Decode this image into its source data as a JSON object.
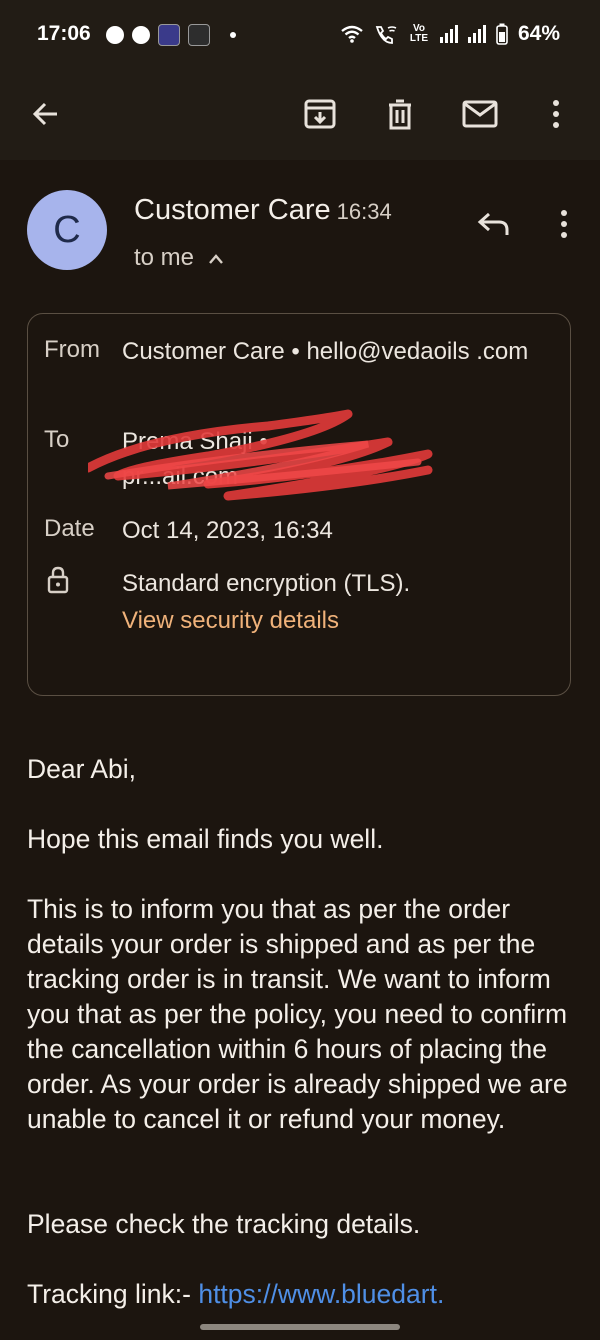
{
  "status_bar": {
    "time": "17:06",
    "battery": "64%",
    "volte_label": "Vo LTE",
    "icons": [
      "chat-bubble-icon",
      "messenger-icon",
      "sony-liv-icon",
      "app-icon",
      "wifi-icon",
      "wifi-calling-icon",
      "volte-icon",
      "signal-icon",
      "signal-icon",
      "battery-icon"
    ]
  },
  "toolbar": {
    "back_icon": "arrow-back-icon",
    "archive_icon": "archive-icon",
    "delete_icon": "trash-icon",
    "mark_unread_icon": "mail-icon",
    "more_icon": "more-vert-icon"
  },
  "header": {
    "avatar_letter": "C",
    "avatar_color": "#a7b4ec",
    "sender_name": "Customer Care",
    "time": "16:34",
    "recipient": "to me",
    "reply_icon": "reply-icon",
    "more_icon": "more-vert-icon"
  },
  "details": {
    "from_label": "From",
    "from_value": "Customer Care • hello@vedaoils .com",
    "to_label": "To",
    "to_value_line1": "Prema Shaji •",
    "to_value_line2": "pr...ail.com",
    "date_label": "Date",
    "date_value": "Oct 14, 2023, 16:34",
    "encryption": "Standard encryption (TLS).",
    "security_link": "View security details",
    "accent_color": "#f0b27a"
  },
  "body": {
    "greeting": "Dear Abi,",
    "para1": "Hope this email finds you well.",
    "para2": "This is to inform you that as per the order details your order is shipped and as per the tracking order is in transit. We want to inform you that as per the policy, you need to confirm the cancellation within 6 hours of placing the order. As your order is already shipped we are unable to cancel it or refund your money.",
    "para3": "Please check the tracking details.",
    "tracking_label": "Tracking link:-",
    "tracking_url": "https://www.bluedart."
  }
}
